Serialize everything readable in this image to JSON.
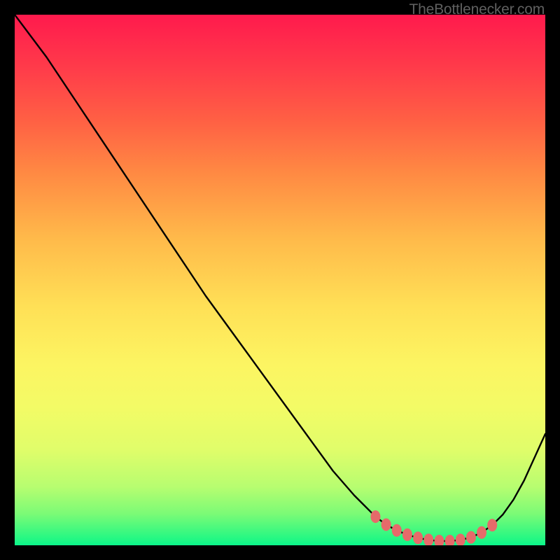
{
  "meta": {
    "source_label": "TheBottlenecker.com"
  },
  "chart_data": {
    "type": "line",
    "title": "",
    "xlabel": "",
    "ylabel": "",
    "xlim": [
      0,
      100
    ],
    "ylim": [
      0,
      100
    ],
    "background_gradient": {
      "stops": [
        {
          "pos": 0,
          "color": "#ff1a4d"
        },
        {
          "pos": 10,
          "color": "#ff3b4a"
        },
        {
          "pos": 20,
          "color": "#ff6044"
        },
        {
          "pos": 30,
          "color": "#ff8a43"
        },
        {
          "pos": 42,
          "color": "#ffb94a"
        },
        {
          "pos": 55,
          "color": "#ffe056"
        },
        {
          "pos": 66,
          "color": "#fcf562"
        },
        {
          "pos": 74,
          "color": "#f3fb66"
        },
        {
          "pos": 82,
          "color": "#e0fd6a"
        },
        {
          "pos": 89,
          "color": "#b7fd70"
        },
        {
          "pos": 94,
          "color": "#7cfb76"
        },
        {
          "pos": 99,
          "color": "#20f784"
        },
        {
          "pos": 100,
          "color": "#0af58a"
        }
      ]
    },
    "series": [
      {
        "name": "bottleneck-curve",
        "color": "#000000",
        "x": [
          0,
          6,
          12,
          20,
          28,
          36,
          44,
          52,
          60,
          64,
          68,
          70,
          72,
          74,
          76,
          78,
          80,
          82,
          84,
          86,
          88,
          90,
          92,
          94,
          96,
          100
        ],
        "y": [
          100,
          92,
          83,
          71,
          59,
          47,
          36,
          25,
          14,
          9.4,
          5.4,
          3.9,
          2.8,
          2.0,
          1.4,
          1.0,
          0.8,
          0.8,
          1.0,
          1.5,
          2.4,
          3.8,
          5.8,
          8.6,
          12.2,
          21
        ]
      },
      {
        "name": "highlight-dots",
        "color": "#e66a6a",
        "type": "scatter",
        "x": [
          68,
          70,
          72,
          74,
          76,
          78,
          80,
          82,
          84,
          86,
          88,
          90
        ],
        "y": [
          5.4,
          3.9,
          2.8,
          2.0,
          1.4,
          1.0,
          0.8,
          0.8,
          1.0,
          1.5,
          2.4,
          3.8
        ]
      }
    ]
  }
}
